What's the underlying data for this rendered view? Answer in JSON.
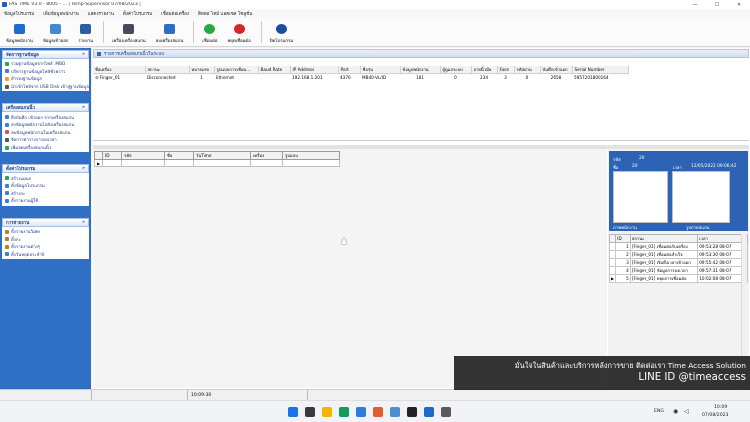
{
  "window": {
    "title": "FAS TIME V3.0 - 8005 - ... | Temp-Supervisor 07/08/2023 |",
    "minimize": "—",
    "maximize": "☐",
    "close": "✕"
  },
  "menu": [
    "ข้อมูลโปรแกรม",
    "เพิ่มข้อมูลพนักงาน",
    "แสดงรายงาน",
    "ตั้งค่าโปรแกรม",
    "เชื่อมต่อเครื่อง",
    "ติดต่อ ไทม์ แอคเซส โซลูชั่น"
  ],
  "toolbar": [
    {
      "label": "ข้อมูลพนักงาน",
      "color": "#1e6cd0"
    },
    {
      "label": "ข้อมูลเข้าออก",
      "color": "#3d8ad6"
    },
    {
      "label": "รายงาน",
      "color": "#2a5fa8"
    },
    {
      "label": "เครื่องเครื่องสแกน",
      "color": "#444c5a"
    },
    {
      "label": "ลบเครื่องสแกน",
      "color": "#2e6fc4"
    },
    {
      "label": "เชื่อมต่อ",
      "color": "#27a844"
    },
    {
      "label": "หยุดเชื่อมต่อ",
      "color": "#d3272b"
    },
    {
      "label": "ปิดโปรแกรม",
      "color": "#1b4f9e"
    }
  ],
  "sidebar": {
    "sections": [
      {
        "title": "จัดการฐานข้อมูล",
        "items": [
          "รวมฐานข้อมูลจากไฟล์ .MBD",
          "บริหารฐานข้อมูลไฟล์ชั่วคราว",
          "สำรองฐานข้อมูล",
          "นำเข้าไฟล์จาก USB Disk เข้าสู่ฐานข้อมูล"
        ]
      },
      {
        "title": "เครื่องสแกนนิ้ว",
        "items": [
          "ดึงบันทึก เข้าออก จากเครื่องสแกน",
          "ส่งข้อมูลพนักงานไปยังเครื่องสแกน",
          "ลบข้อมูลพนักงานในเครื่องสแกน",
          "จัดการตารางการลงเวลา",
          "เพิ่มลดเครื่องสแกนนิ้ว"
        ]
      },
      {
        "title": "ตั้งค่าโปรแกรม",
        "items": [
          "สร้างแผนก",
          "ตั้งข้อมูลโปรแกรม",
          "สร้างกะ",
          "ตั้งรายงานผู้ใช้"
        ]
      },
      {
        "title": "การจ่ายงาน",
        "items": [
          "ตั้งรายงานวิเศษ",
          "ตั้งกะ",
          "ตั้งรายงานต่างๆ",
          "ตั้งวันหยุดประจำปี"
        ]
      }
    ],
    "collapse_icon": "»"
  },
  "content": {
    "title": "รายการเครื่องสแกนนิ้วในระบบ",
    "devices": {
      "columns": [
        "ชื่อเครื่อง",
        "สถานะ",
        "หมายเลข",
        "รูปแบบการเชื่อม...",
        "Baud Rate",
        "IP Address",
        "Port",
        "ชื่อรุ่น",
        "ข้อมูลพนักงาน",
        "ผู้ดูแลระบบ",
        "ลายนิ้วมือ",
        "Face",
        "รหัสผ่าน",
        "บันทึกเข้าออก",
        "Serial Number"
      ],
      "rows": [
        [
          "Finger_01",
          "Disconnected",
          "1",
          "Ethernet",
          "",
          "192.168.1.201",
          "4370",
          "MB40-VL/ID",
          "181",
          "0",
          "234",
          "3",
          "0",
          "2658",
          "5957201800164"
        ]
      ]
    },
    "log": {
      "columns": [
        "ID",
        "รหัส",
        "ชื่อ",
        "วันTime",
        "เครื่อง",
        "รูปแบบ"
      ],
      "row_marker": "▶"
    }
  },
  "right_panel": {
    "code_label": "รหัส",
    "code_value": "20",
    "name_label": "ชื่อ",
    "name_value": "20",
    "time_label": "เวลา",
    "time_value": "12/05/2022 09:06:42",
    "photo_label": "ภาพพนักงาน",
    "scan_label": "รูปถ่ายสแกน",
    "events": {
      "columns": [
        "ID",
        "สถานะ",
        "เวลา"
      ],
      "rows": [
        [
          "1",
          "[Finger_01] เชื่อมต่อกับเครื่อง",
          "09:53:28 08-07"
        ],
        [
          "2",
          "[Finger_01] เชื่อมต่อสำเร็จ",
          "09:53:30 08-07"
        ],
        [
          "3",
          "[Finger_01] เริ่มดึงเวลาเข้าออก",
          "09:55:42 08-07"
        ],
        [
          "4",
          "[Finger_01] ข้อมูลการลงเวลา",
          "09:57:31 08-07"
        ],
        [
          "5",
          "[Finger_01] หยุดการเชื่อมต่อ",
          "10:02:08 08-07"
        ]
      ],
      "row_marker": "▶"
    }
  },
  "status": {
    "time": "10:09:30"
  },
  "watermark": {
    "line1": "มั่นใจในสินค้าและบริการหลังการขาย ติดต่อเรา Time Access Solution",
    "line2": "LINE ID @timeaccess"
  },
  "taskbar": {
    "icons": [
      {
        "name": "windows-start-icon",
        "color": "#1a73e8"
      },
      {
        "name": "taskview-icon",
        "color": "#3a3a3a"
      },
      {
        "name": "file-explorer-icon",
        "color": "#f4b400"
      },
      {
        "name": "edge-browser-icon",
        "color": "#0f9d58"
      },
      {
        "name": "store-icon",
        "color": "#2d7be0"
      },
      {
        "name": "app-icon",
        "color": "#e05d2d"
      },
      {
        "name": "image-viewer-icon",
        "color": "#4a8fd1"
      },
      {
        "name": "terminal-icon",
        "color": "#222222"
      },
      {
        "name": "mail-icon",
        "color": "#1b6ac9"
      },
      {
        "name": "window-icon",
        "color": "#5a5a5a"
      }
    ],
    "lang": "ENG",
    "clock_time": "10:09",
    "clock_date": "07/08/2023"
  }
}
